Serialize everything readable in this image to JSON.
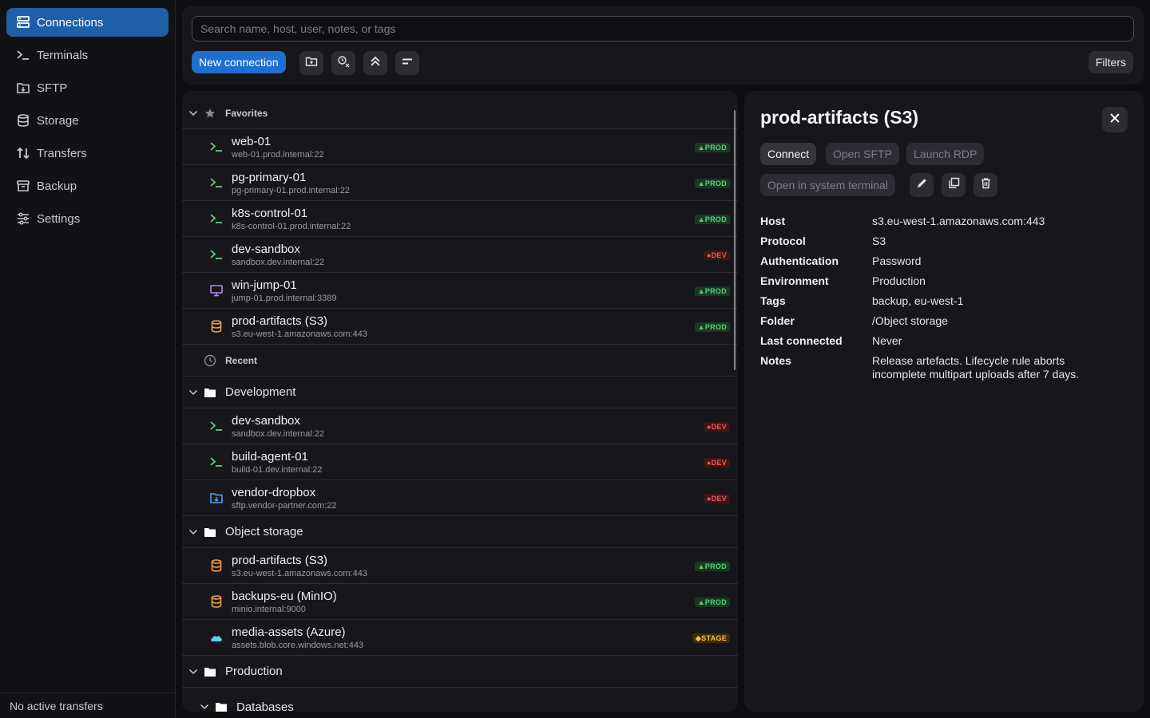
{
  "sidebar": {
    "items": [
      {
        "label": "Connections",
        "icon": "connections-icon",
        "active": true
      },
      {
        "label": "Terminals",
        "icon": "terminal-icon"
      },
      {
        "label": "SFTP",
        "icon": "sftp-icon"
      },
      {
        "label": "Storage",
        "icon": "storage-icon"
      },
      {
        "label": "Transfers",
        "icon": "transfers-icon"
      },
      {
        "label": "Backup",
        "icon": "backup-icon"
      },
      {
        "label": "Settings",
        "icon": "settings-icon"
      }
    ],
    "footer": "No active transfers"
  },
  "toolbar": {
    "search_placeholder": "Search name, host, user, notes, or tags",
    "new_connection": "New connection",
    "filters": "Filters",
    "icon_buttons": [
      "new-folder-icon",
      "clear-recent-icon",
      "collapse-all-icon",
      "sort-icon"
    ]
  },
  "list": {
    "favorites": {
      "label": "Favorites",
      "rows": [
        {
          "name": "web-01",
          "host": "web-01.prod.internal:22",
          "type": "ssh",
          "env": "PROD"
        },
        {
          "name": "pg-primary-01",
          "host": "pg-primary-01.prod.internal:22",
          "type": "ssh",
          "env": "PROD"
        },
        {
          "name": "k8s-control-01",
          "host": "k8s-control-01.prod.internal:22",
          "type": "ssh",
          "env": "PROD"
        },
        {
          "name": "dev-sandbox",
          "host": "sandbox.dev.internal:22",
          "type": "ssh",
          "env": "DEV"
        },
        {
          "name": "win-jump-01",
          "host": "jump-01.prod.internal:3389",
          "type": "rdp",
          "env": "PROD"
        },
        {
          "name": "prod-artifacts (S3)",
          "host": "s3.eu-west-1.amazonaws.com:443",
          "type": "storage",
          "env": "PROD"
        }
      ]
    },
    "recent": {
      "label": "Recent"
    },
    "development": {
      "label": "Development",
      "rows": [
        {
          "name": "dev-sandbox",
          "host": "sandbox.dev.internal:22",
          "type": "ssh",
          "env": "DEV"
        },
        {
          "name": "build-agent-01",
          "host": "build-01.dev.internal:22",
          "type": "ssh",
          "env": "DEV"
        },
        {
          "name": "vendor-dropbox",
          "host": "sftp.vendor-partner.com:22",
          "type": "sftp",
          "env": "DEV"
        }
      ]
    },
    "object_storage": {
      "label": "Object storage",
      "rows": [
        {
          "name": "prod-artifacts (S3)",
          "host": "s3.eu-west-1.amazonaws.com:443",
          "type": "storage",
          "env": "PROD"
        },
        {
          "name": "backups-eu (MinIO)",
          "host": "minio.internal:9000",
          "type": "storage",
          "env": "PROD"
        },
        {
          "name": "media-assets (Azure)",
          "host": "assets.blob.core.windows.net:443",
          "type": "cloud",
          "env": "STAGE"
        }
      ]
    },
    "production": {
      "label": "Production"
    },
    "databases": {
      "label": "Databases"
    }
  },
  "detail": {
    "title": "prod-artifacts (S3)",
    "actions": {
      "connect": "Connect",
      "open_sftp": "Open SFTP",
      "launch_rdp": "Launch RDP",
      "open_terminal": "Open in system terminal"
    },
    "fields": [
      {
        "label": "Host",
        "value": "s3.eu-west-1.amazonaws.com:443"
      },
      {
        "label": "Protocol",
        "value": "S3"
      },
      {
        "label": "Authentication",
        "value": "Password"
      },
      {
        "label": "Environment",
        "value": "Production"
      },
      {
        "label": "Tags",
        "value": "backup, eu-west-1"
      },
      {
        "label": "Folder",
        "value": "/Object storage"
      },
      {
        "label": "Last connected",
        "value": "Never"
      },
      {
        "label": "Notes",
        "value": "Release artefacts. Lifecycle rule aborts incomplete multipart uploads after 7 days."
      }
    ]
  },
  "colors": {
    "accent": "#1f6fd1",
    "active_nav": "#1f5fa8",
    "prod": "#56d07a",
    "dev": "#f05a5a",
    "stage": "#f2c23c",
    "storage_icon": "#f0a04b",
    "rdp_icon": "#b58cf0",
    "sftp_icon": "#5aa0f0",
    "cloud_icon": "#5ed0e8"
  }
}
